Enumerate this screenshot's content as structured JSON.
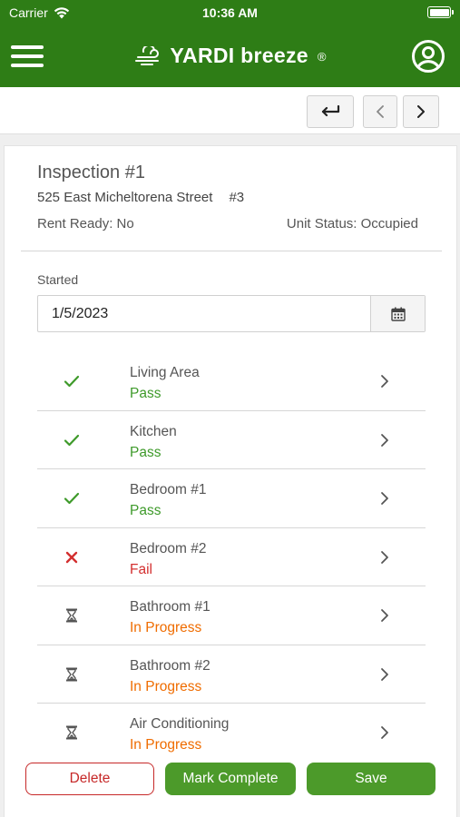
{
  "status_bar": {
    "carrier": "Carrier",
    "time": "10:36 AM"
  },
  "header": {
    "brand": "YARDI breeze",
    "registered": "®"
  },
  "inspection": {
    "title": "Inspection #1",
    "address": "525 East Micheltorena Street",
    "unit": "#3",
    "rent_ready": "Rent Ready: No",
    "unit_status": "Unit Status: Occupied",
    "started_label": "Started",
    "started_value": "1/5/2023"
  },
  "rooms": [
    {
      "name": "Living Area",
      "status": "Pass",
      "icon": "check-icon",
      "color": "#3e9a2a"
    },
    {
      "name": "Kitchen",
      "status": "Pass",
      "icon": "check-icon",
      "color": "#3e9a2a"
    },
    {
      "name": "Bedroom #1",
      "status": "Pass",
      "icon": "check-icon",
      "color": "#3e9a2a"
    },
    {
      "name": "Bedroom #2",
      "status": "Fail",
      "icon": "x-icon",
      "color": "#d32f2f"
    },
    {
      "name": "Bathroom #1",
      "status": "In Progress",
      "icon": "hourglass-icon",
      "color": "#ef6c00"
    },
    {
      "name": "Bathroom #2",
      "status": "In Progress",
      "icon": "hourglass-icon",
      "color": "#ef6c00"
    },
    {
      "name": "Air Conditioning",
      "status": "In Progress",
      "icon": "hourglass-icon",
      "color": "#ef6c00"
    }
  ],
  "actions": {
    "delete": "Delete",
    "mark_complete": "Mark Complete",
    "save": "Save"
  },
  "colors": {
    "brand_green": "#2e7d16",
    "button_green": "#4c9a2a",
    "delete_red": "#c62828"
  }
}
